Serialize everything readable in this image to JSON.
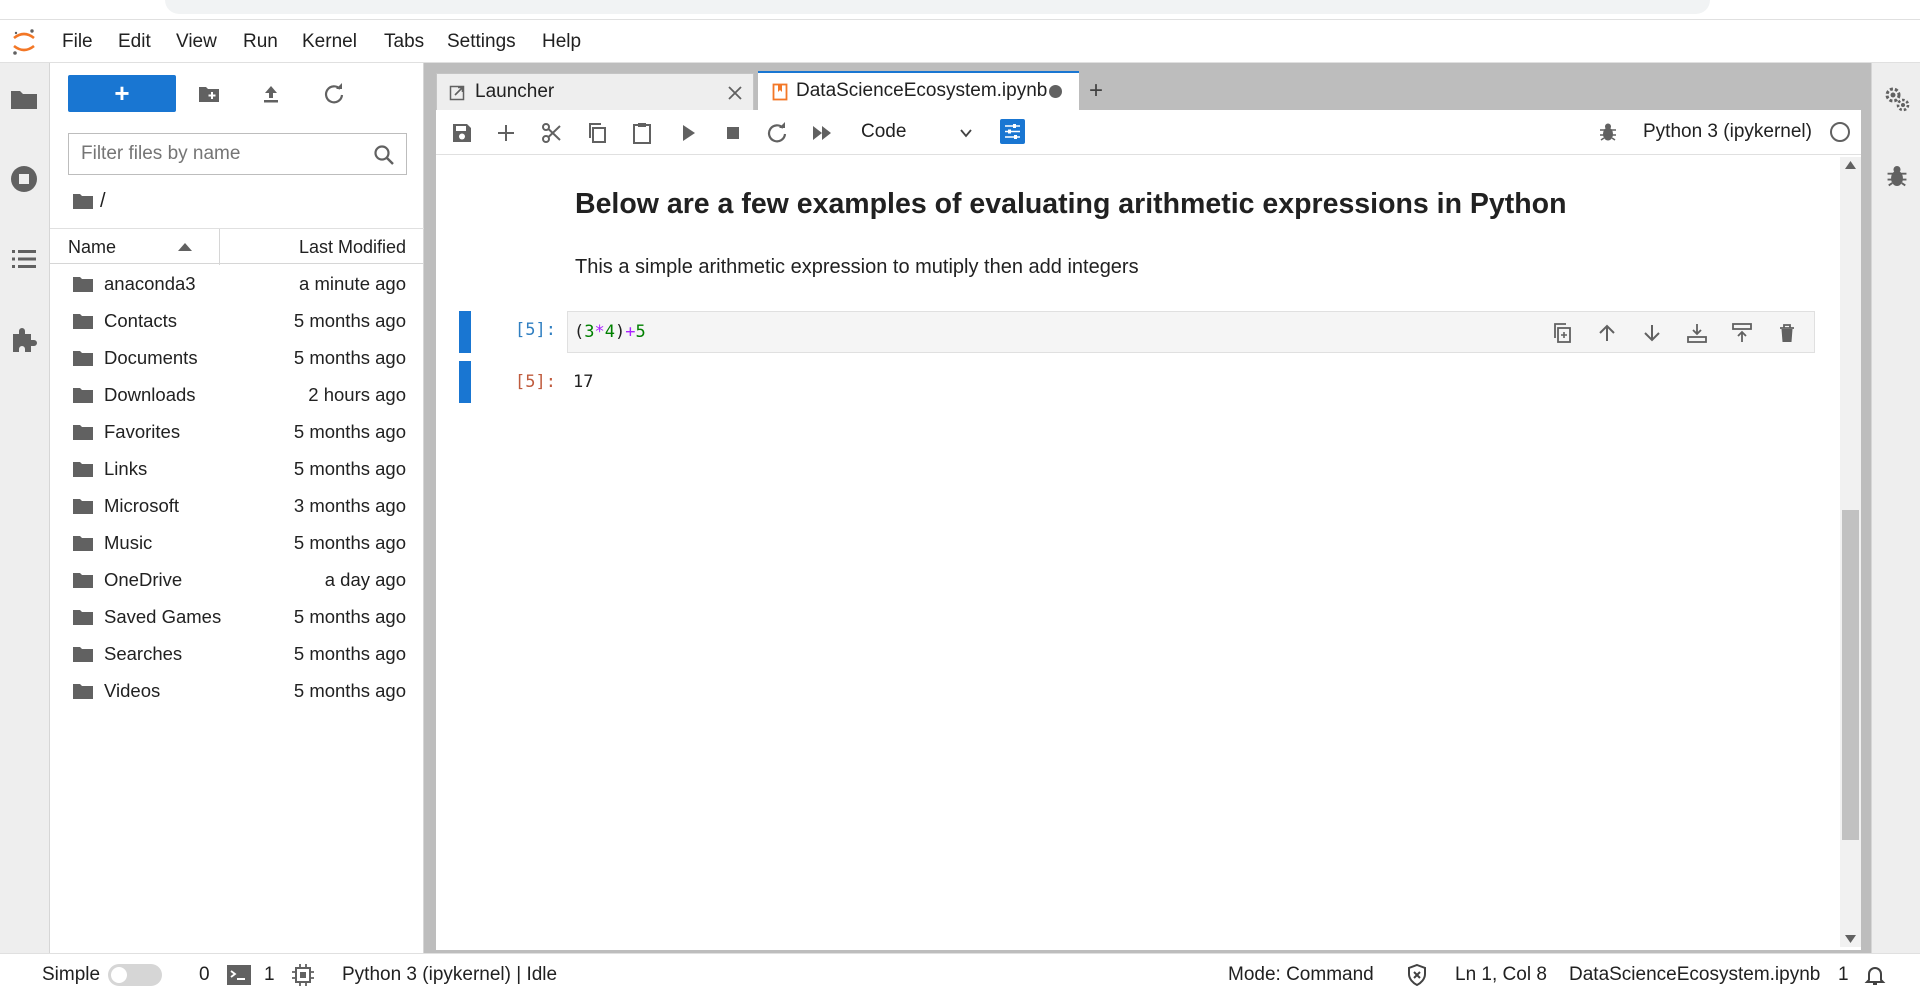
{
  "menubar": {
    "items": [
      "File",
      "Edit",
      "View",
      "Run",
      "Kernel",
      "Tabs",
      "Settings",
      "Help"
    ]
  },
  "filebrowser": {
    "new_button_label": "+",
    "filter_placeholder": "Filter files by name",
    "breadcrumb": "/",
    "columns": {
      "name": "Name",
      "modified": "Last Modified"
    },
    "rows": [
      {
        "name": "anaconda3",
        "modified": "a minute ago"
      },
      {
        "name": "Contacts",
        "modified": "5 months ago"
      },
      {
        "name": "Documents",
        "modified": "5 months ago"
      },
      {
        "name": "Downloads",
        "modified": "2 hours ago"
      },
      {
        "name": "Favorites",
        "modified": "5 months ago"
      },
      {
        "name": "Links",
        "modified": "5 months ago"
      },
      {
        "name": "Microsoft",
        "modified": "3 months ago"
      },
      {
        "name": "Music",
        "modified": "5 months ago"
      },
      {
        "name": "OneDrive",
        "modified": "a day ago"
      },
      {
        "name": "Saved Games",
        "modified": "5 months ago"
      },
      {
        "name": "Searches",
        "modified": "5 months ago"
      },
      {
        "name": "Videos",
        "modified": "5 months ago"
      }
    ]
  },
  "tabs": {
    "launcher": "Launcher",
    "notebook": "DataScienceEcosystem.ipynb",
    "add": "+"
  },
  "toolbar": {
    "cell_type": "Code",
    "kernel": "Python 3 (ipykernel)"
  },
  "notebook": {
    "heading": "Below are a few examples of evaluating arithmetic expressions in Python",
    "paragraph": "This a simple arithmetic expression to mutiply then add integers",
    "cell": {
      "in_prompt": "[5]:",
      "out_prompt": "[5]:",
      "code": "(3*4)+5",
      "output": "17"
    }
  },
  "statusbar": {
    "simple_label": "Simple",
    "terminals_count": "0",
    "kernels_count": "1",
    "kernel_status": "Python 3 (ipykernel) | Idle",
    "mode": "Mode: Command",
    "cursor": "Ln 1, Col 8",
    "filename": "DataScienceEcosystem.ipynb",
    "notifications": "1"
  },
  "colors": {
    "accent": "#1976d2",
    "jupyter_orange": "#f37726",
    "input_prompt": "#307fc1",
    "output_prompt": "#bf5b3d"
  },
  "icons": {
    "left_activity": [
      "folder-icon",
      "running-icon",
      "toc-icon",
      "extension-icon"
    ],
    "right_activity": [
      "property-inspector-icon",
      "debugger-icon"
    ]
  }
}
